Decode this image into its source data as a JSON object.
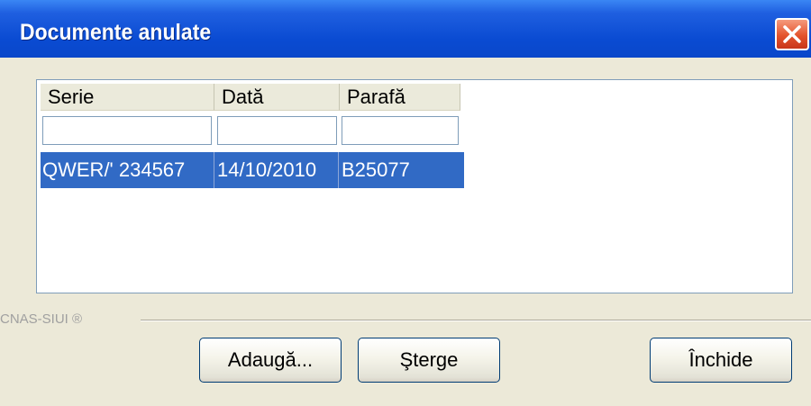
{
  "window": {
    "title": "Documente anulate",
    "close_icon": "close-icon"
  },
  "table": {
    "columns": [
      "Serie",
      "Dată",
      "Parafă"
    ],
    "filters": [
      "",
      "",
      ""
    ],
    "rows": [
      {
        "serie": "QWER/' 234567",
        "data": "14/10/2010",
        "parafa": "B25077",
        "selected": true
      }
    ],
    "selection_color": "#316ac5"
  },
  "footer": {
    "brand": "CNAS-SIUI ®"
  },
  "buttons": {
    "add": "Adaugă...",
    "delete": "Şterge",
    "close": "Închide"
  }
}
